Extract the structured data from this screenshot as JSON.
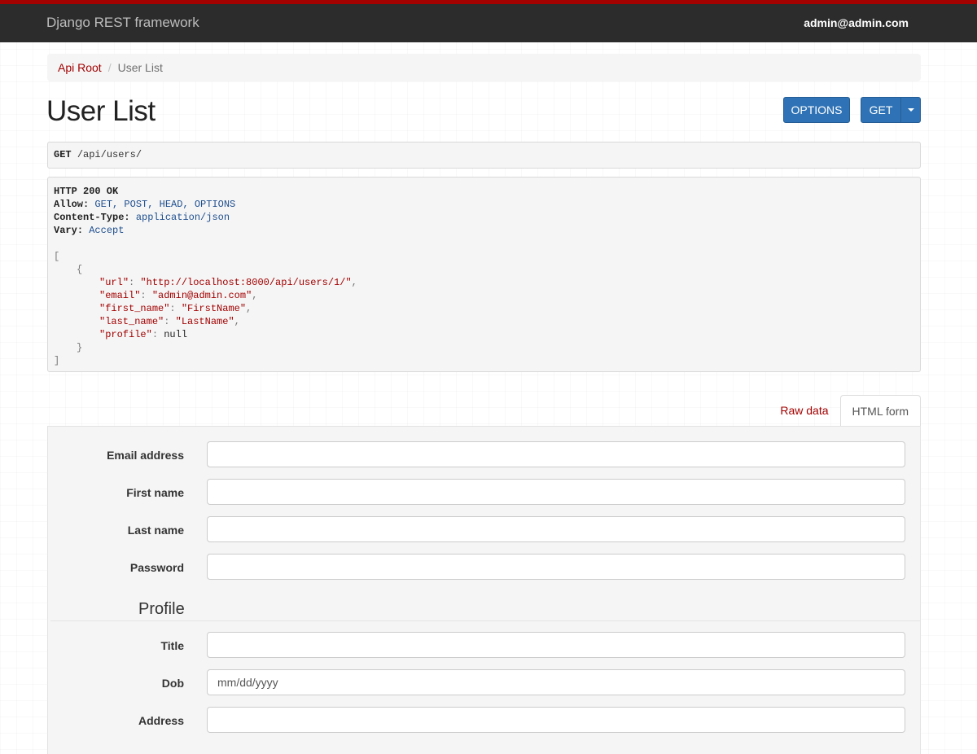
{
  "navbar": {
    "brand": "Django REST framework",
    "user": "admin@admin.com",
    "accent_color": "#a30000",
    "background_color": "#2c2c2c"
  },
  "breadcrumb": {
    "items": [
      "Api Root",
      "User List"
    ],
    "separator": "/"
  },
  "page": {
    "title": "User List"
  },
  "actions": {
    "options_label": "OPTIONS",
    "get_label": "GET",
    "button_color": "#2f73b6"
  },
  "request": {
    "method": "GET",
    "path": "/api/users/"
  },
  "response": {
    "status": "HTTP 200 OK",
    "headers": [
      {
        "key": "Allow",
        "value": "GET, POST, HEAD, OPTIONS"
      },
      {
        "key": "Content-Type",
        "value": "application/json"
      },
      {
        "key": "Vary",
        "value": "Accept"
      }
    ],
    "open_bracket": "[",
    "open_brace": "{",
    "fields": [
      {
        "key": "url",
        "value": "http://localhost:8000/api/users/1/",
        "type": "string"
      },
      {
        "key": "email",
        "value": "admin@admin.com",
        "type": "string"
      },
      {
        "key": "first_name",
        "value": "FirstName",
        "type": "string"
      },
      {
        "key": "last_name",
        "value": "LastName",
        "type": "string"
      },
      {
        "key": "profile",
        "value": "null",
        "type": "null"
      }
    ],
    "close_brace": "}",
    "close_bracket": "]"
  },
  "tabs": {
    "raw_data": "Raw data",
    "html_form": "HTML form",
    "active": "html_form"
  },
  "form": {
    "fields": [
      {
        "label": "Email address",
        "value": "",
        "placeholder": ""
      },
      {
        "label": "First name",
        "value": "",
        "placeholder": ""
      },
      {
        "label": "Last name",
        "value": "",
        "placeholder": ""
      },
      {
        "label": "Password",
        "value": "",
        "placeholder": ""
      }
    ],
    "profile_legend": "Profile",
    "profile_fields": [
      {
        "label": "Title",
        "value": "",
        "placeholder": ""
      },
      {
        "label": "Dob",
        "value": "",
        "placeholder": "mm/dd/yyyy"
      },
      {
        "label": "Address",
        "value": "",
        "placeholder": ""
      }
    ]
  }
}
